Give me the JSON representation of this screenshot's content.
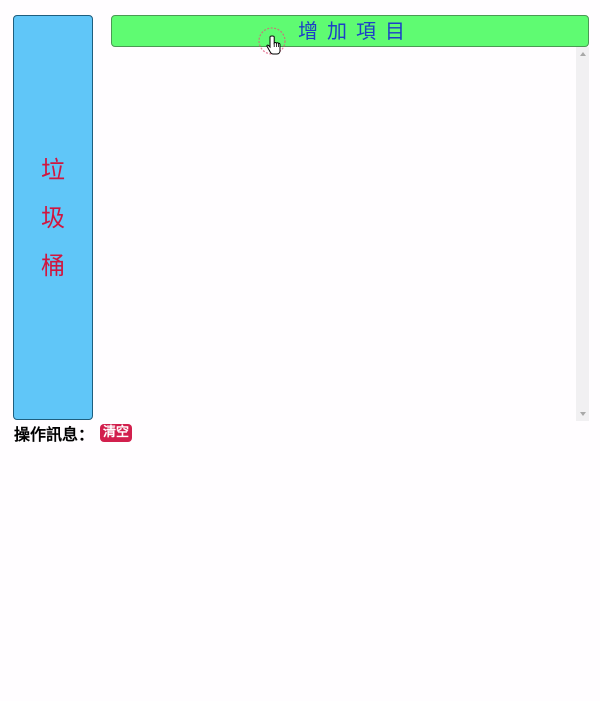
{
  "trash": {
    "label": "垃圾桶",
    "color": "#60c6f8",
    "text_color": "#d0163f"
  },
  "add_button": {
    "label": "增加項目",
    "color": "#5ffb72",
    "text_color": "#1d3fc8"
  },
  "item_list": {
    "items": []
  },
  "log": {
    "label": "操作訊息：",
    "clear_label": "清空",
    "clear_color": "#d21f4d"
  },
  "cursor": {
    "icon": "hand-pointer-icon"
  }
}
